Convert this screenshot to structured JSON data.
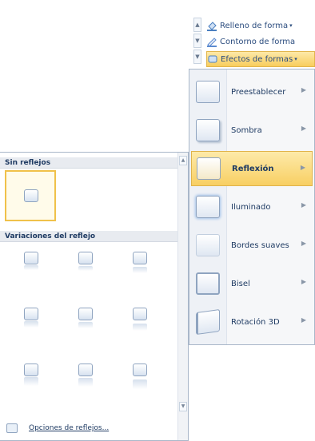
{
  "ribbon": {
    "items": [
      {
        "label": "Relleno de forma",
        "icon": "fill-bucket-icon",
        "color": "#4a7fc0"
      },
      {
        "label": "Contorno de forma",
        "icon": "pen-outline-icon",
        "color": "#5b8ad0"
      },
      {
        "label": "Efectos de formas",
        "icon": "shape-effects-icon",
        "color": "#e0a020"
      }
    ]
  },
  "menu": {
    "items": [
      {
        "label": "Preestablecer"
      },
      {
        "label": "Sombra"
      },
      {
        "label": "Reflexión"
      },
      {
        "label": "Iluminado"
      },
      {
        "label": "Bordes suaves"
      },
      {
        "label": "Bisel"
      },
      {
        "label": "Rotación 3D"
      }
    ],
    "selected": "Reflexión"
  },
  "gallery": {
    "section_no_reflection": "Sin reflejos",
    "section_variations": "Variaciones del reflejo",
    "options_label": "Opciones de reflejos..."
  },
  "colors": {
    "highlight": "#f8cd5d",
    "border": "#a9b7c9",
    "text": "#1f3b63"
  }
}
